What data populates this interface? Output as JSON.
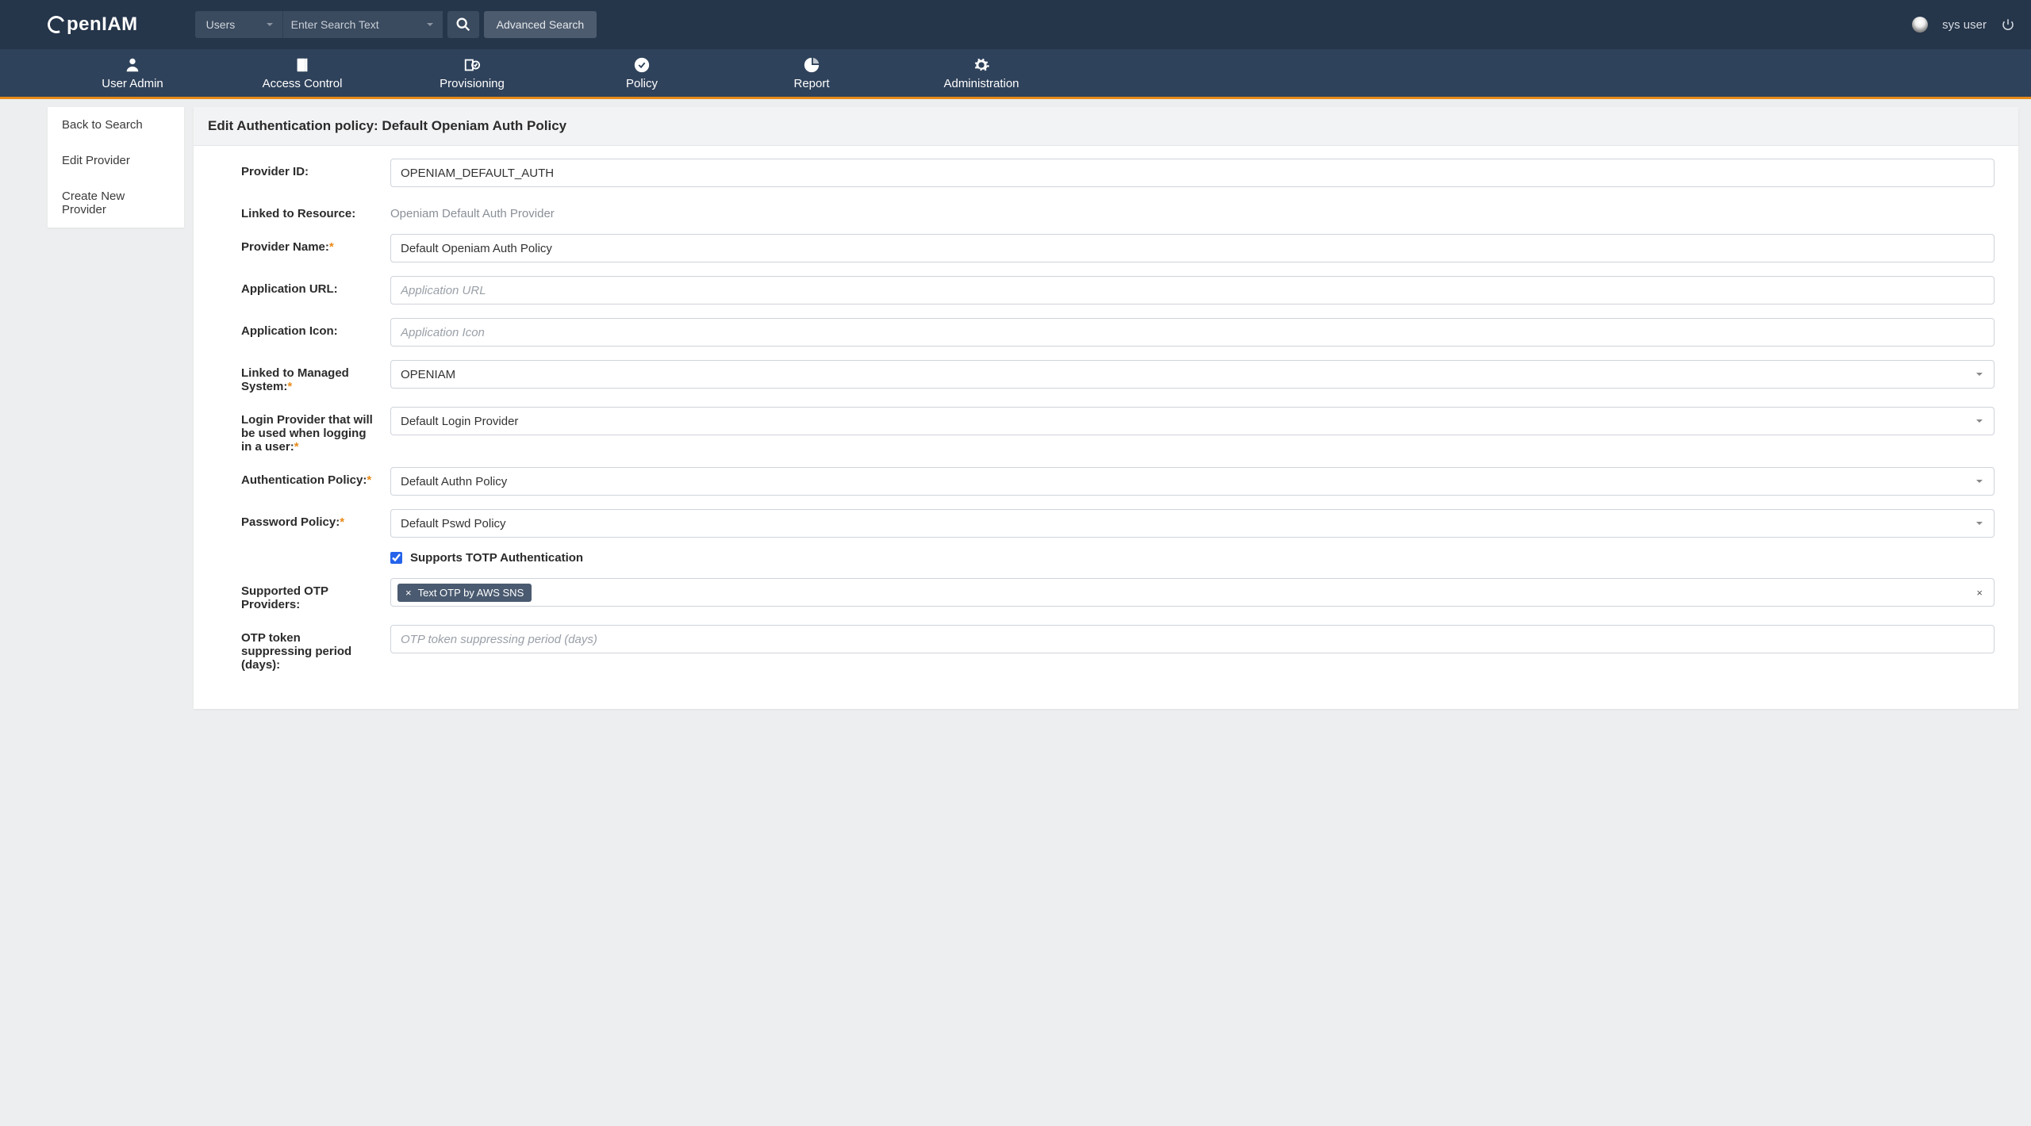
{
  "header": {
    "logo_text": "penIAM",
    "search_category": "Users",
    "search_placeholder": "Enter Search Text",
    "adv_search": "Advanced Search",
    "username": "sys user"
  },
  "nav": [
    {
      "id": "user-admin",
      "label": "User Admin"
    },
    {
      "id": "access-control",
      "label": "Access Control"
    },
    {
      "id": "provisioning",
      "label": "Provisioning"
    },
    {
      "id": "policy",
      "label": "Policy"
    },
    {
      "id": "report",
      "label": "Report"
    },
    {
      "id": "administration",
      "label": "Administration"
    }
  ],
  "sidebar": [
    {
      "label": "Back to Search"
    },
    {
      "label": "Edit Provider"
    },
    {
      "label": "Create New Provider"
    }
  ],
  "panel": {
    "title": "Edit Authentication policy: Default Openiam Auth Policy"
  },
  "form": {
    "provider_id": {
      "label": "Provider ID:",
      "value": "OPENIAM_DEFAULT_AUTH"
    },
    "linked_resource": {
      "label": "Linked to Resource:",
      "value": "Openiam Default Auth Provider"
    },
    "provider_name": {
      "label": "Provider Name:",
      "value": "Default Openiam Auth Policy"
    },
    "app_url": {
      "label": "Application URL:",
      "placeholder": "Application URL",
      "value": ""
    },
    "app_icon": {
      "label": "Application Icon:",
      "placeholder": "Application Icon",
      "value": ""
    },
    "managed_system": {
      "label": "Linked to Managed System:",
      "value": "OPENIAM"
    },
    "login_provider": {
      "label": "Login Provider that will be used when logging in a user:",
      "value": "Default Login Provider"
    },
    "auth_policy": {
      "label": "Authentication Policy:",
      "value": "Default Authn Policy"
    },
    "pwd_policy": {
      "label": "Password Policy:",
      "value": "Default Pswd Policy"
    },
    "totp": {
      "label": "Supports TOTP Authentication",
      "checked": true
    },
    "otp_providers": {
      "label": "Supported OTP Providers:",
      "tags": [
        "Text OTP by AWS SNS"
      ]
    },
    "otp_suppress": {
      "label": "OTP token suppressing period (days):",
      "placeholder": "OTP token suppressing period (days)",
      "value": ""
    }
  }
}
